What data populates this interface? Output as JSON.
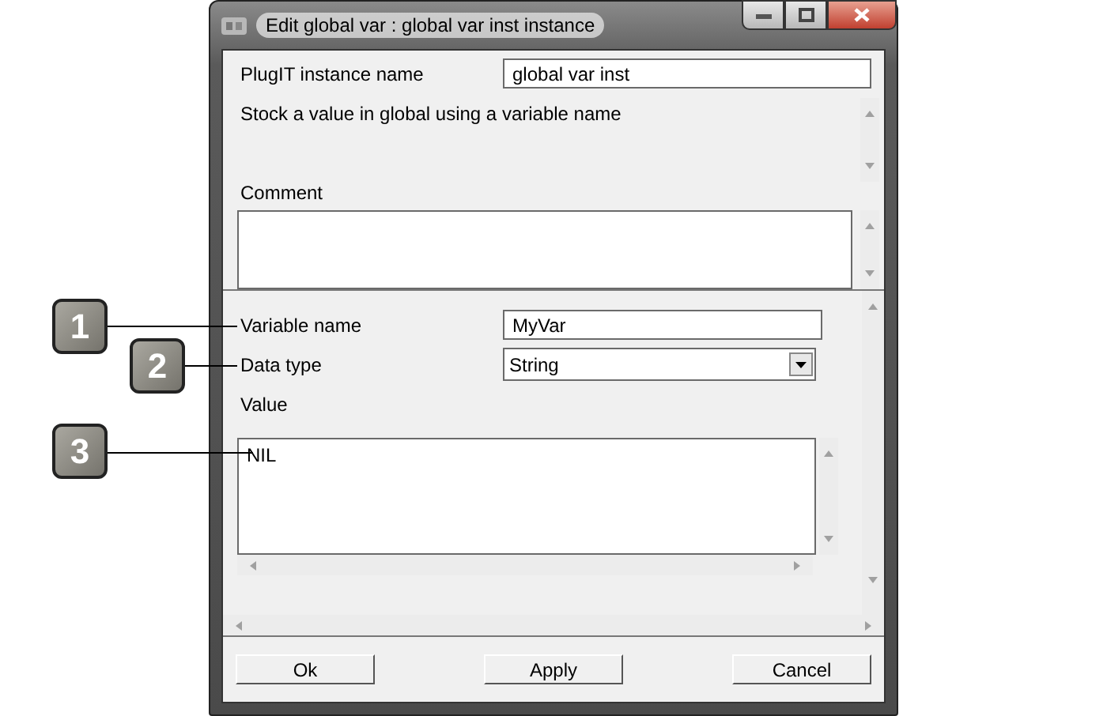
{
  "window": {
    "title": "Edit global var : global var inst instance"
  },
  "instance": {
    "label": "PlugIT instance name",
    "value": "global var inst"
  },
  "description": "Stock a value in global using a variable name",
  "comment": {
    "label": "Comment"
  },
  "parameters": [
    {
      "kind": "text",
      "label": "Variable name",
      "value": "MyVar"
    },
    {
      "kind": "select",
      "label": "Data type",
      "value": "String"
    },
    {
      "kind": "textarea",
      "label": "Value",
      "value": "NIL"
    }
  ],
  "buttons": [
    "Ok",
    "Apply",
    "Cancel"
  ],
  "callouts": [
    "1",
    "2",
    "3"
  ]
}
